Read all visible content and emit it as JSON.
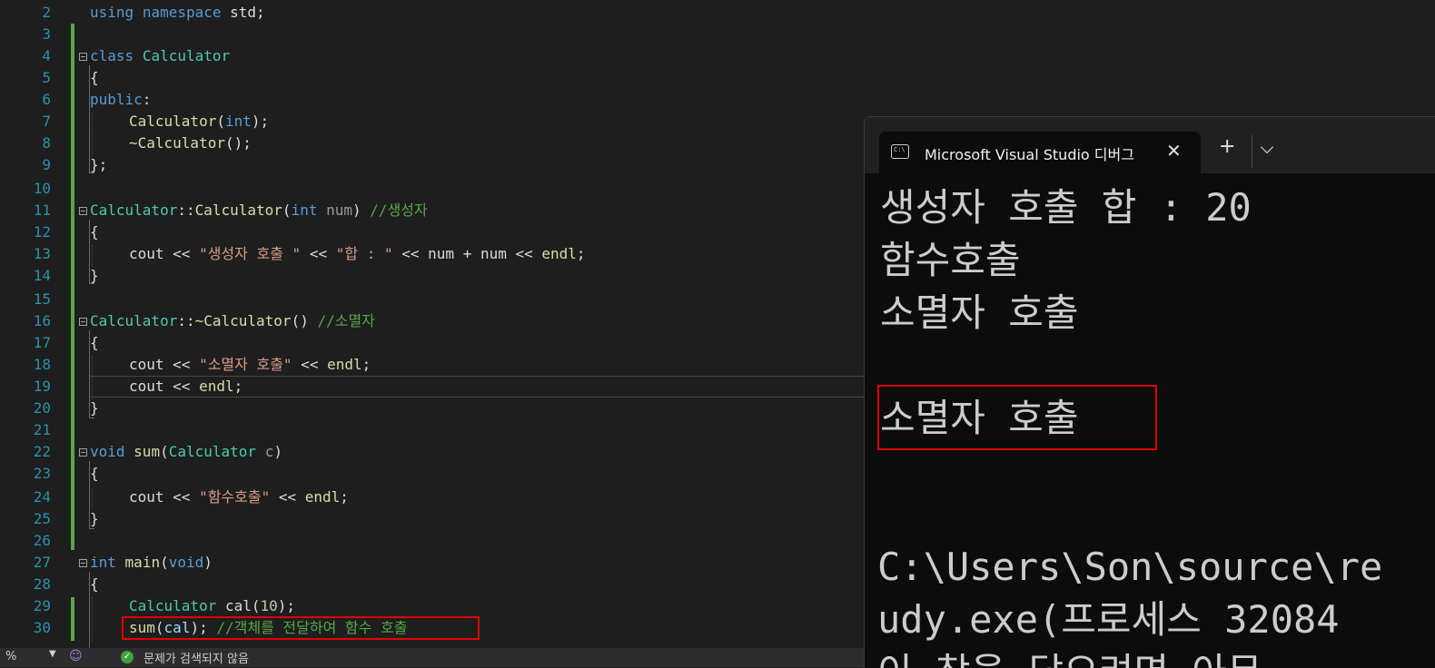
{
  "editor": {
    "line_numbers": [
      "2",
      "3",
      "4",
      "5",
      "6",
      "7",
      "8",
      "9",
      "10",
      "11",
      "12",
      "13",
      "14",
      "15",
      "16",
      "17",
      "18",
      "19",
      "20",
      "21",
      "22",
      "23",
      "24",
      "25",
      "26",
      "27",
      "28",
      "29",
      "30"
    ],
    "lines": {
      "l2": {
        "kw_using": "using",
        "kw_namespace": "namespace",
        "rest": " std;"
      },
      "l4": {
        "kw": "class",
        "name": "Calculator"
      },
      "l5": {
        "text": "{"
      },
      "l6": {
        "kw": "public",
        "rest": ":"
      },
      "l7": {
        "name": "Calculator",
        "open": "(",
        "kw": "int",
        "close": ");"
      },
      "l8": {
        "name": "~Calculator",
        "rest": "();"
      },
      "l9": {
        "text": "};"
      },
      "l11": {
        "cls": "Calculator",
        "sep": "::",
        "fn": "Calculator",
        "open": "(",
        "kw": "int",
        "param": "num",
        "close": ")",
        "comment": "//생성자"
      },
      "l12": {
        "text": "{"
      },
      "l13": {
        "a": "cout << ",
        "s1": "\"생성자 호출 \"",
        "b": " << ",
        "s2": "\"합 : \"",
        "c": " << num + num << ",
        "endl": "endl",
        "d": ";"
      },
      "l14": {
        "text": "}"
      },
      "l16": {
        "cls": "Calculator",
        "sep": "::",
        "fn": "~Calculator",
        "rest": "()",
        "comment": "//소멸자"
      },
      "l17": {
        "text": "{"
      },
      "l18": {
        "a": "cout << ",
        "s1": "\"소멸자 호출\"",
        "b": " << ",
        "endl": "endl",
        "d": ";"
      },
      "l19": {
        "a": "cout << ",
        "endl": "endl",
        "d": ";"
      },
      "l20": {
        "text": "}"
      },
      "l22": {
        "kw": "void",
        "fn": "sum",
        "open": "(",
        "type": "Calculator",
        "param": "c",
        "close": ")"
      },
      "l23": {
        "text": "{"
      },
      "l24": {
        "a": "cout << ",
        "s1": "\"함수호출\"",
        "b": " << ",
        "endl": "endl",
        "d": ";"
      },
      "l25": {
        "text": "}"
      },
      "l27": {
        "kw": "int",
        "fn": "main",
        "open": "(",
        "kw2": "void",
        "close": ")"
      },
      "l28": {
        "text": "{"
      },
      "l29": {
        "type": "Calculator",
        "var": "cal",
        "open": "(",
        "num": "10",
        "close": ");"
      },
      "l30": {
        "fn": "sum",
        "open": "(",
        "var": "cal",
        "close": ");",
        "comment": "//객체를 전달하여 함수 호출"
      }
    }
  },
  "statusbar": {
    "zoom": "%",
    "issues_message": "문제가 검색되지 않음"
  },
  "terminal": {
    "tab_title": "Microsoft Visual Studio 디버그",
    "tab_icon_text": "C:\\",
    "output_lines": [
      "생성자 호출 합 : 20",
      "함수호출",
      "소멸자 호출",
      "",
      "소멸자 호출"
    ],
    "path_lines": [
      "C:\\Users\\Son\\source\\re",
      "udy.exe(프로세스 32084",
      "이 창을 닫으려면 아무"
    ]
  },
  "colors": {
    "editor_bg": "#1e1e1e",
    "terminal_bg": "#0c0c0c",
    "highlight_box": "#e00000",
    "change_bar": "#57a64a"
  }
}
